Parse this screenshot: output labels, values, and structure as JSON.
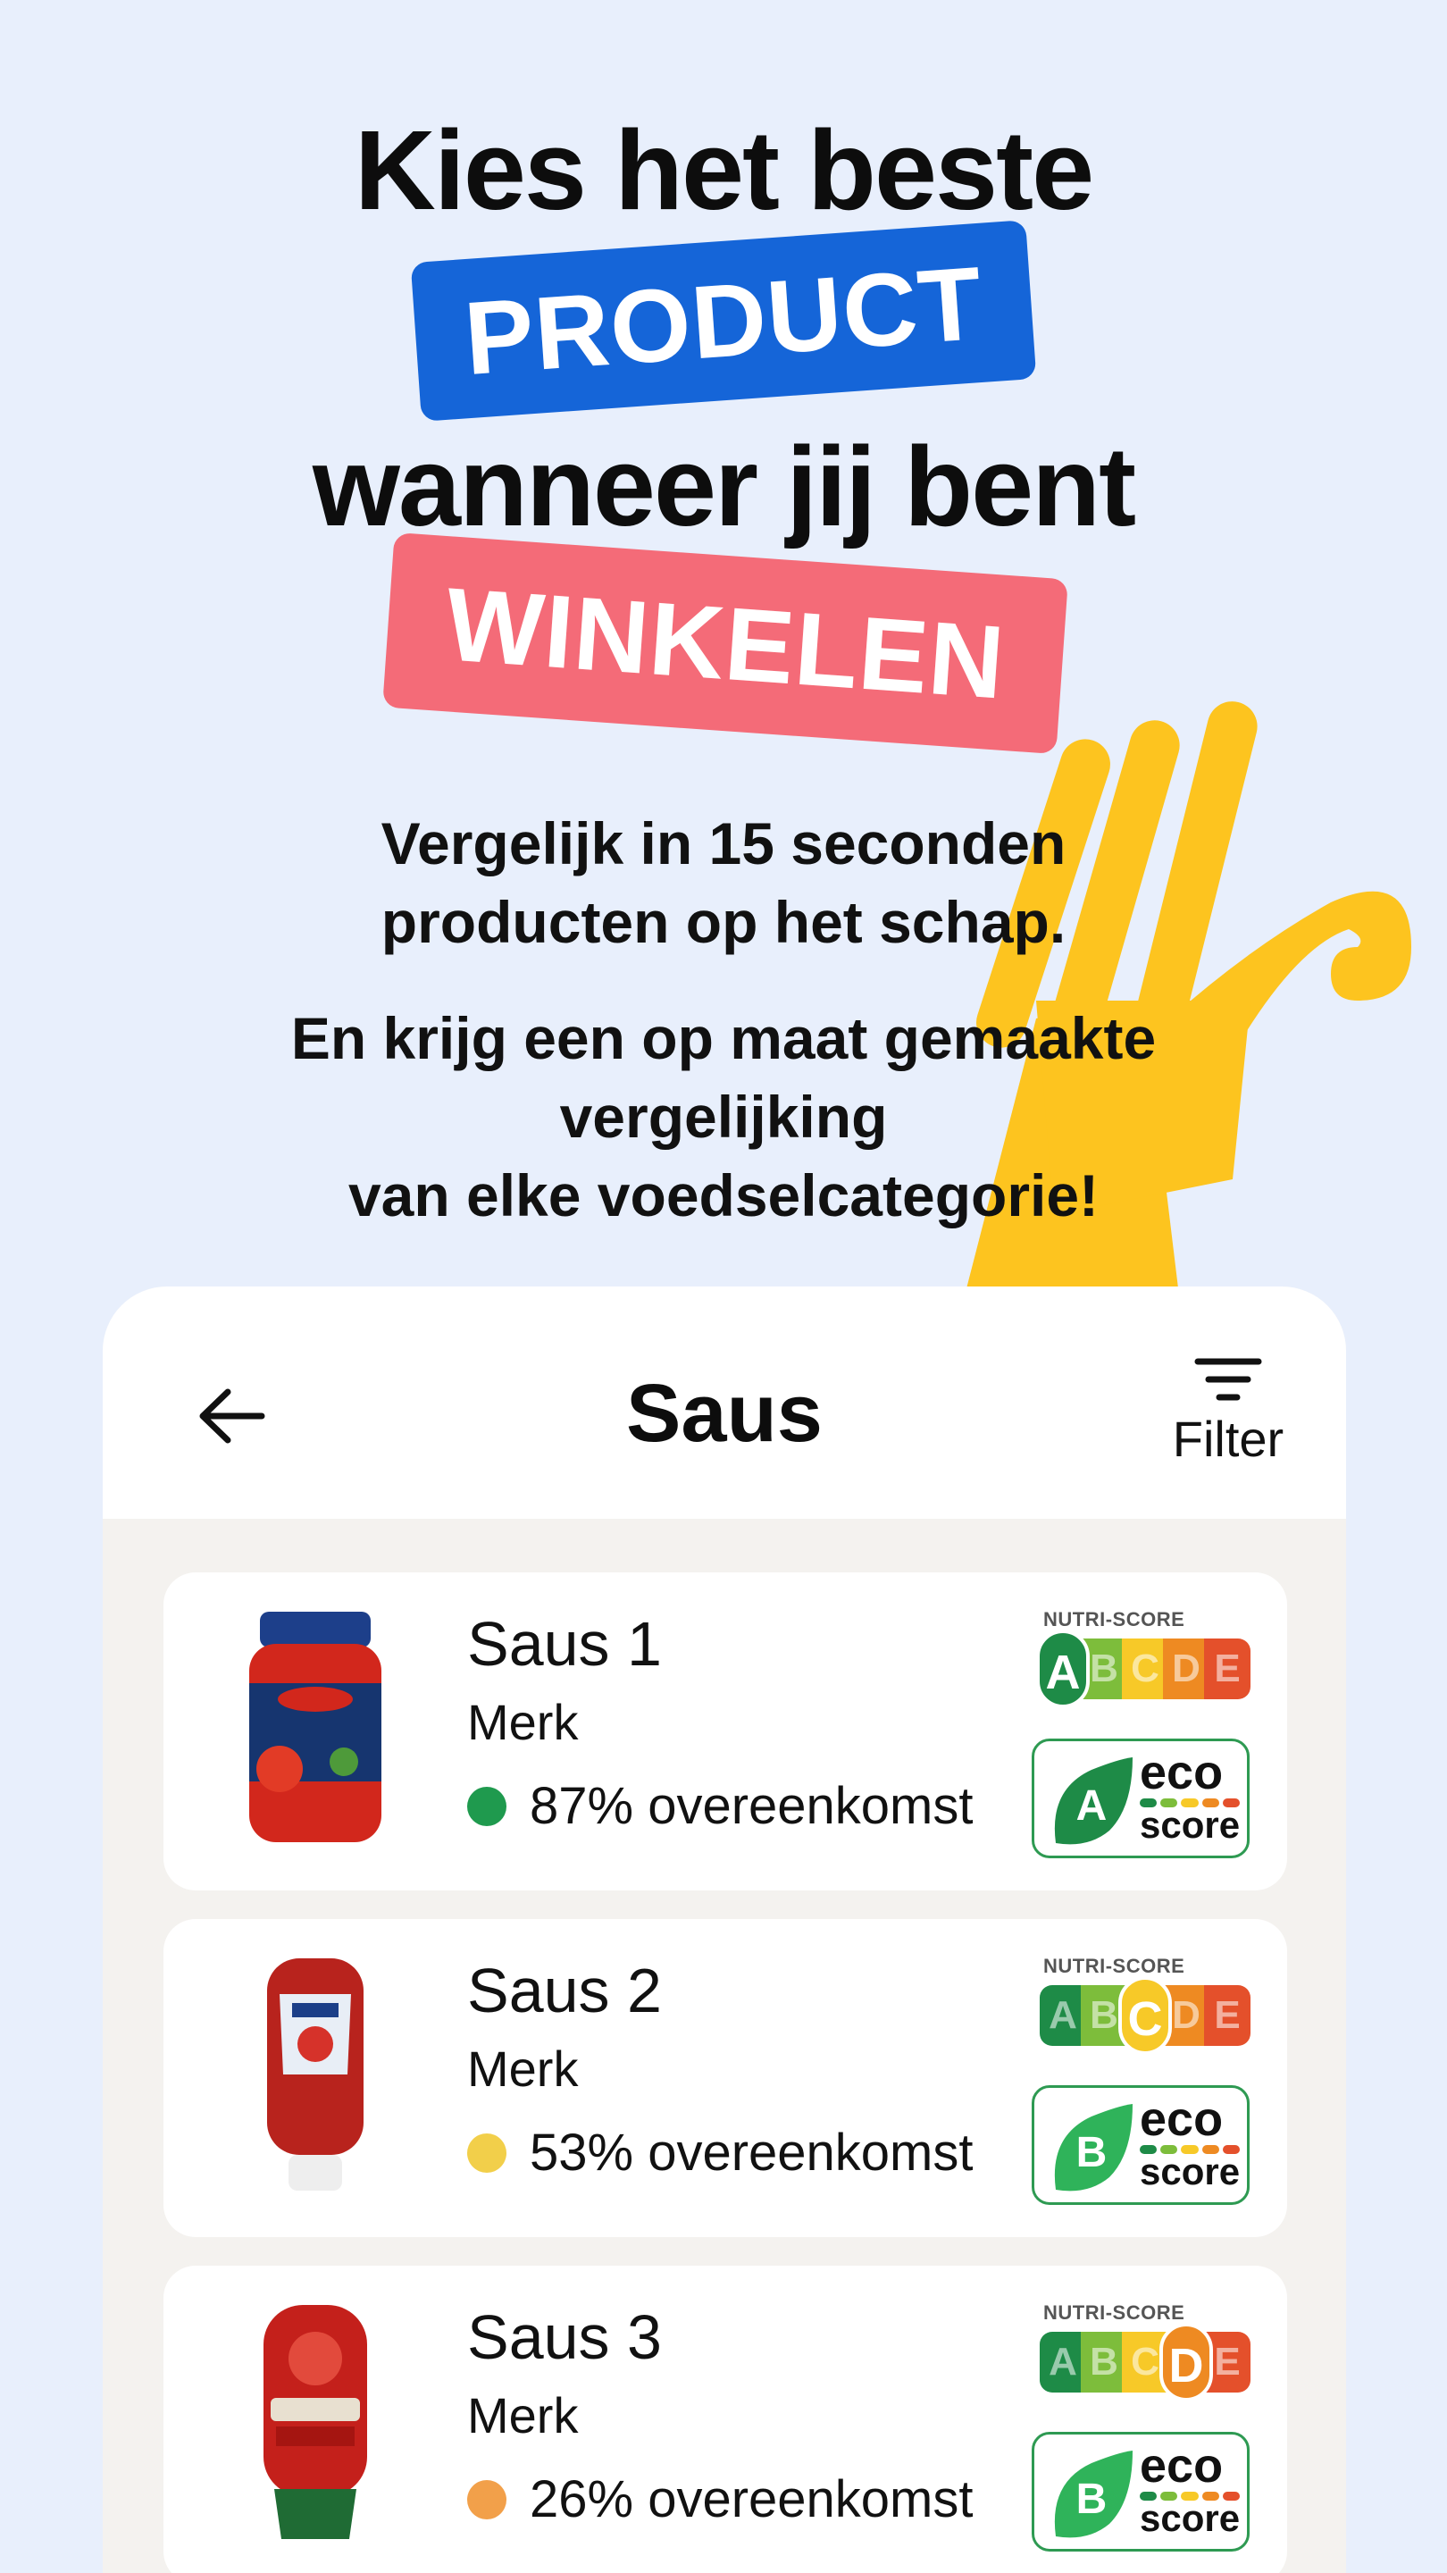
{
  "hero": {
    "line1": "Kies het beste",
    "tag1": "PRODUCT",
    "line2": "wanneer jij bent",
    "tag2": "WINKELEN",
    "sub1_line1": "Vergelijk in 15 seconden",
    "sub1_line2": "producten op het schap.",
    "sub2_line1": "En krijg een op maat gemaakte",
    "sub2_line2": "vergelijking",
    "sub2_line3": "van elke voedselcategorie!"
  },
  "screen": {
    "title": "Saus",
    "filter_label": "Filter"
  },
  "nutri_label": "NUTRI-SCORE",
  "nutri_letters": [
    "A",
    "B",
    "C",
    "D",
    "E"
  ],
  "eco_word1": "eco",
  "eco_word2": "score",
  "products": [
    {
      "name": "Saus 1",
      "brand": "Merk",
      "match": "87% overeenkomst",
      "match_color": "#1f9a4e",
      "nutri_grade": "A",
      "eco_grade": "A",
      "image": "pasta-sauce-jar"
    },
    {
      "name": "Saus 2",
      "brand": "Merk",
      "match": "53% overeenkomst",
      "match_color": "#f2cf4a",
      "nutri_grade": "C",
      "eco_grade": "B",
      "image": "ketchup-bottle"
    },
    {
      "name": "Saus 3",
      "brand": "Merk",
      "match": "26% overeenkomst",
      "match_color": "#f2a04a",
      "nutri_grade": "D",
      "eco_grade": "B",
      "image": "ketchup-bottle-red"
    }
  ],
  "colors": {
    "background": "#e8effc",
    "tag_blue": "#1565d8",
    "tag_red": "#f46b78",
    "hand_yellow": "#fdc41f",
    "nutri_a": "#1e8b47",
    "nutri_b": "#7dbd3b",
    "nutri_c": "#f7c928",
    "nutri_d": "#ee8a22",
    "nutri_e": "#e4502b"
  }
}
